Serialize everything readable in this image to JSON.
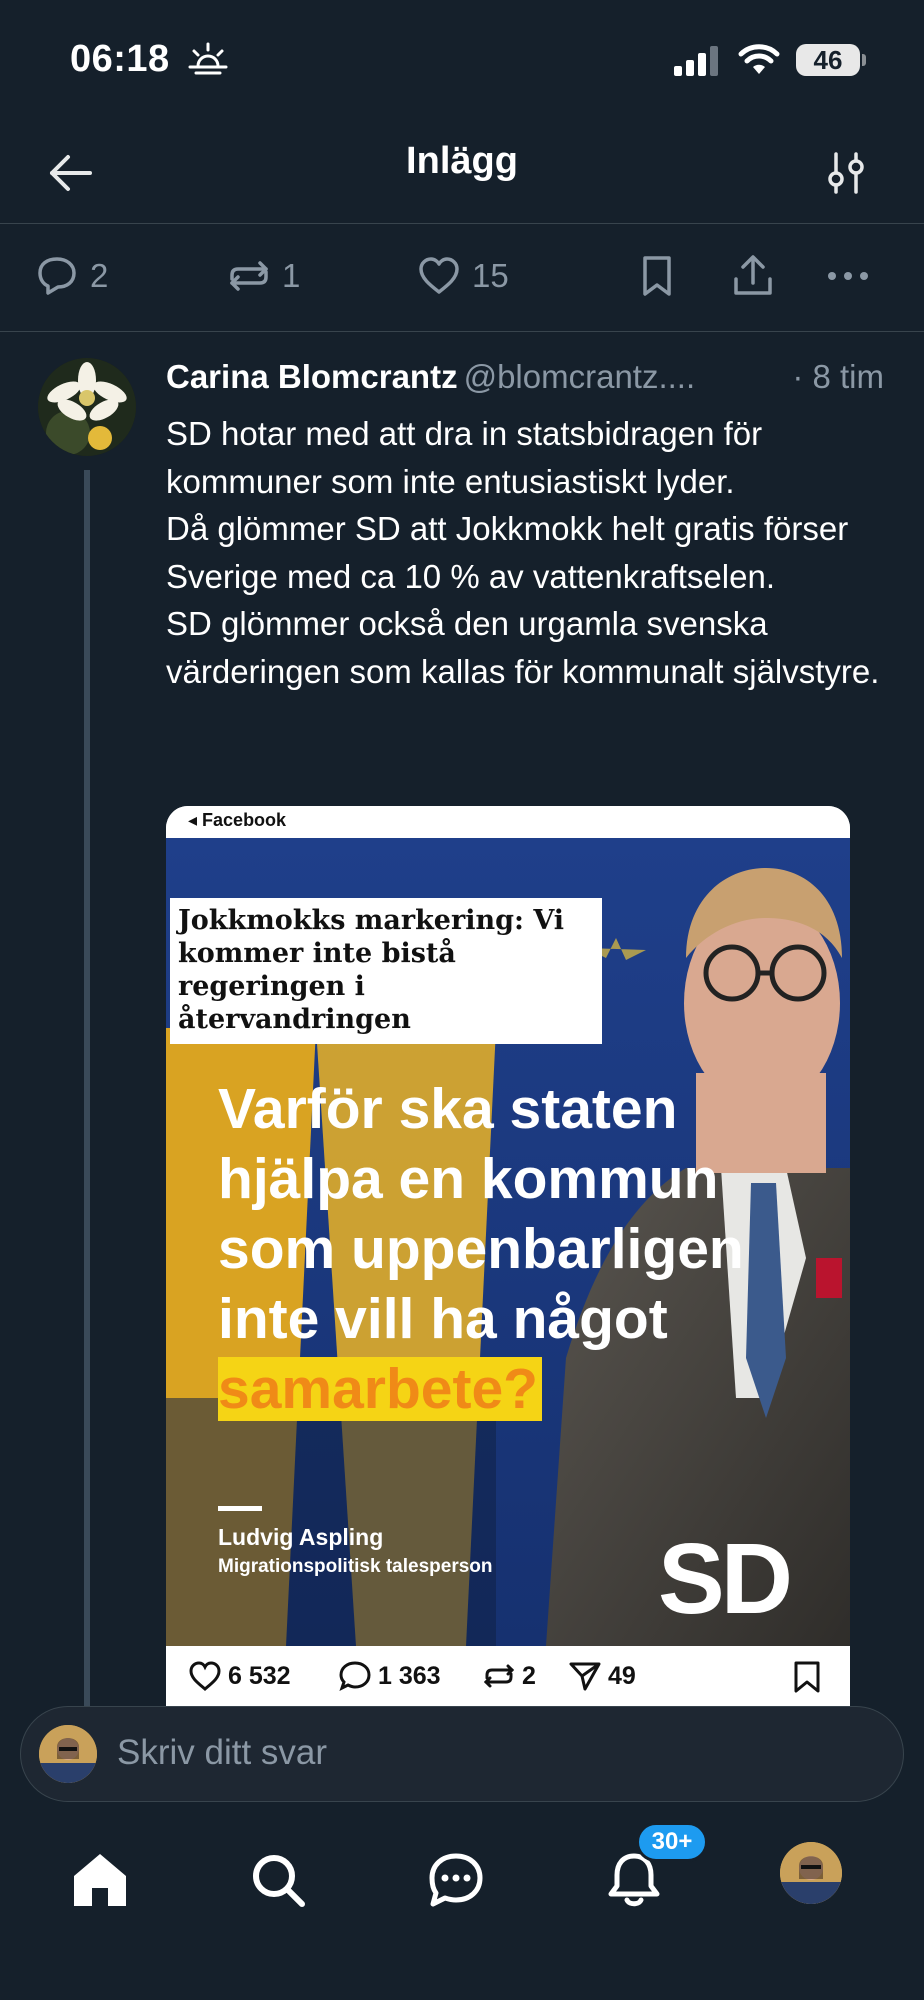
{
  "status_bar": {
    "time": "06:18",
    "battery": "46"
  },
  "header": {
    "title": "Inlägg"
  },
  "actions": {
    "replies": "2",
    "reposts": "1",
    "likes": "15"
  },
  "tweet": {
    "author_name": "Carina Blomcrantz",
    "author_handle": "@blomcrantz....",
    "time": "· 8 tim",
    "text": "SD hotar med att dra in statsbidragen för kommuner som inte entusiastiskt lyder.\nDå glömmer SD att Jokkmokk helt gratis förser Sverige med ca 10 % av vattenkraftselen.\nSD glömmer också den urgamla svenska värderingen som kallas för kommunalt självstyre."
  },
  "media": {
    "source_label": "◂ Facebook",
    "headline": "Jokkmokks markering: Vi kommer inte bistå regeringen i återvandringen",
    "big_text_line1": "Varför ska staten",
    "big_text_line2": "hjälpa en kommun",
    "big_text_line3": "som uppenbarligen",
    "big_text_line4": "inte vill ha något",
    "big_text_highlight": "samarbete?",
    "person_name": "Ludvig Aspling",
    "person_role": "Migrationspolitisk talesperson",
    "logo_text": "SD",
    "ig_likes": "6 532",
    "ig_comments": "1 363",
    "ig_reposts": "2",
    "ig_shares": "49"
  },
  "reply": {
    "placeholder": "Skriv ditt svar"
  },
  "tabs": {
    "notification_badge": "30+"
  },
  "colors": {
    "background": "#15202b",
    "muted": "#8b98a5",
    "accent": "#1d9bf0",
    "divider": "#38444d"
  }
}
